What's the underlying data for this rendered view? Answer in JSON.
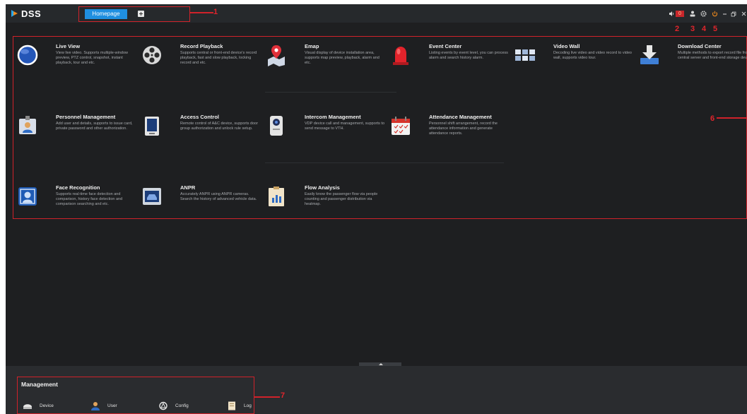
{
  "app": {
    "logo_text": "DSS"
  },
  "tabs": {
    "home_label": "Homepage"
  },
  "status": {
    "alarm_count": "0"
  },
  "annotations": [
    "1",
    "2",
    "3",
    "4",
    "5",
    "6",
    "7"
  ],
  "modules": [
    {
      "title": "Live View",
      "desc": "View live video. Supports multiple-window preview, PTZ control, snapshot, instant playback, tour and etc.",
      "icon": "globe-icon"
    },
    {
      "title": "Record Playback",
      "desc": "Supports central or front-end device's record playback, fast and slow playback, locking record and etc.",
      "icon": "film-reel-icon"
    },
    {
      "title": "Emap",
      "desc": "Visual display of device installation area, supports map preview, playback, alarm and etc.",
      "icon": "map-pin-icon"
    },
    {
      "title": "Event Center",
      "desc": "Listing events by event level, you can process alarm and search history alarm.",
      "icon": "siren-icon"
    },
    {
      "title": "Video Wall",
      "desc": "Decoding live video and video record to video wall, supports video tour.",
      "icon": "video-wall-icon"
    },
    {
      "title": "Download Center",
      "desc": "Multiple methods to export record file from central server and front-end storage device.",
      "icon": "download-icon"
    },
    {
      "title": "Personnel Management",
      "desc": "Add user and details, supports to issue card, private password and other authorization.",
      "icon": "id-card-icon"
    },
    {
      "title": "Access Control",
      "desc": "Remote control of A&C device, supports door group authorization and unlock rule setup.",
      "icon": "door-icon"
    },
    {
      "title": "Intercom Management",
      "desc": "VDP device call and management, supports to send message to VTH.",
      "icon": "intercom-icon"
    },
    {
      "title": "Attendance Management",
      "desc": "Personnel shift arrangement, record the attendance information and generate attendance reports.",
      "icon": "calendar-icon"
    },
    {
      "title": "Face Recognition",
      "desc": "Supports real-time face detection and comparison, history face detection and comparison searching and etc.",
      "icon": "face-icon"
    },
    {
      "title": "ANPR",
      "desc": "Accurately ANPR using ANPR cameras. Search the history of advanced vehicle data.",
      "icon": "license-plate-icon"
    },
    {
      "title": "Flow Analysis",
      "desc": "Easily know the passenger flow via people counting and passenger distribution via heatmap.",
      "icon": "bar-chart-icon"
    }
  ],
  "management": {
    "title": "Management",
    "items": [
      {
        "label": "Device",
        "icon": "device-icon"
      },
      {
        "label": "User",
        "icon": "user-icon"
      },
      {
        "label": "Config",
        "icon": "config-icon"
      },
      {
        "label": "Log",
        "icon": "log-icon"
      }
    ]
  }
}
